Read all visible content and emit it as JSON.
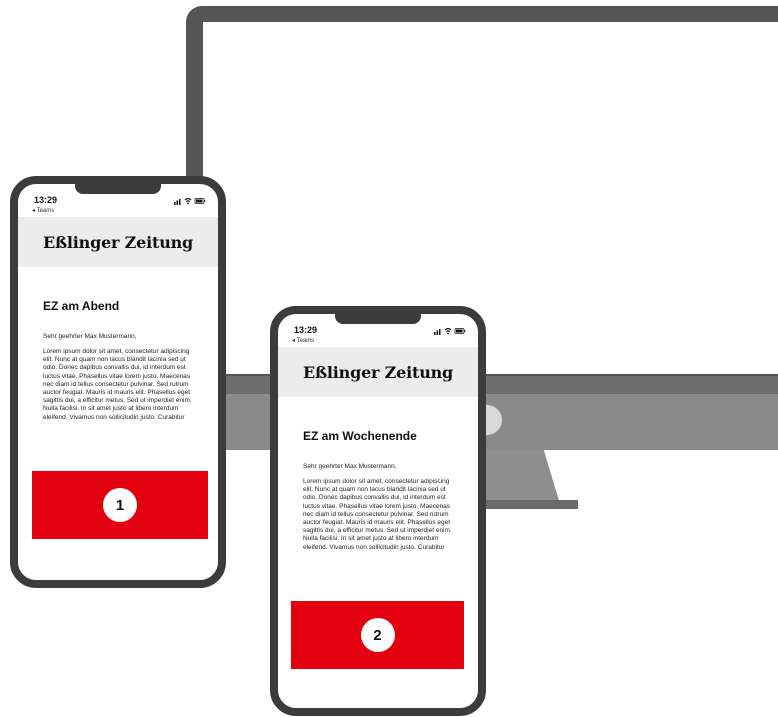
{
  "phones": [
    {
      "time": "13:29",
      "back_label": "◂ Teams",
      "status_icons": "signal-wifi-battery",
      "brand": "Eßlinger Zeitung",
      "headline": "EZ am Abend",
      "greeting": "Sehr geehrter Max Mustermann,",
      "body": "Lorem ipsum dolor sit amet, consectetur adipiscing elit. Nunc at quam non lacus blandit lacinia sed ut odio. Donec dapibus convallis dui, id interdum est luctus vitae. Phasellus vitae lorem justo. Maecenas nec diam id tellus consectetur pulvinar. Sed rutrum auctor feugiat. Mauris id mauris elit. Phasellus eget sagittis dui, a efficitur metus. Sed ut imperdiet enim. Nulla facilisi. In sit amet justo at libero interdum eleifend. Vivamus non sollicitudin justo. Curabitur",
      "badge": "1"
    },
    {
      "time": "13:29",
      "back_label": "◂ Teams",
      "status_icons": "signal-wifi-battery",
      "brand": "Eßlinger Zeitung",
      "headline": "EZ am Wochenende",
      "greeting": "Sehr geehrter Max Mustermann,",
      "body": "Lorem ipsum dolor sit amet, consectetur adipiscing elit. Nunc at quam non lacus blandit lacinia sed ut odio. Donec dapibus convallis dui, id interdum est luctus vitae. Phasellus vitae lorem justo. Maecenas nec diam id tellus consectetur pulvinar. Sed rutrum auctor feugiat. Mauris id mauris elit. Phasellus eget sagittis dui, a efficitur metus. Sed ut imperdiet enim. Nulla facilisi. In sit amet justo at libero interdum eleifend. Vivamus non sollicitudin justo. Curabitur",
      "badge": "2"
    }
  ],
  "colors": {
    "accent_red": "#e3000f",
    "frame": "#3c3c3c",
    "banner": "#ececec"
  }
}
